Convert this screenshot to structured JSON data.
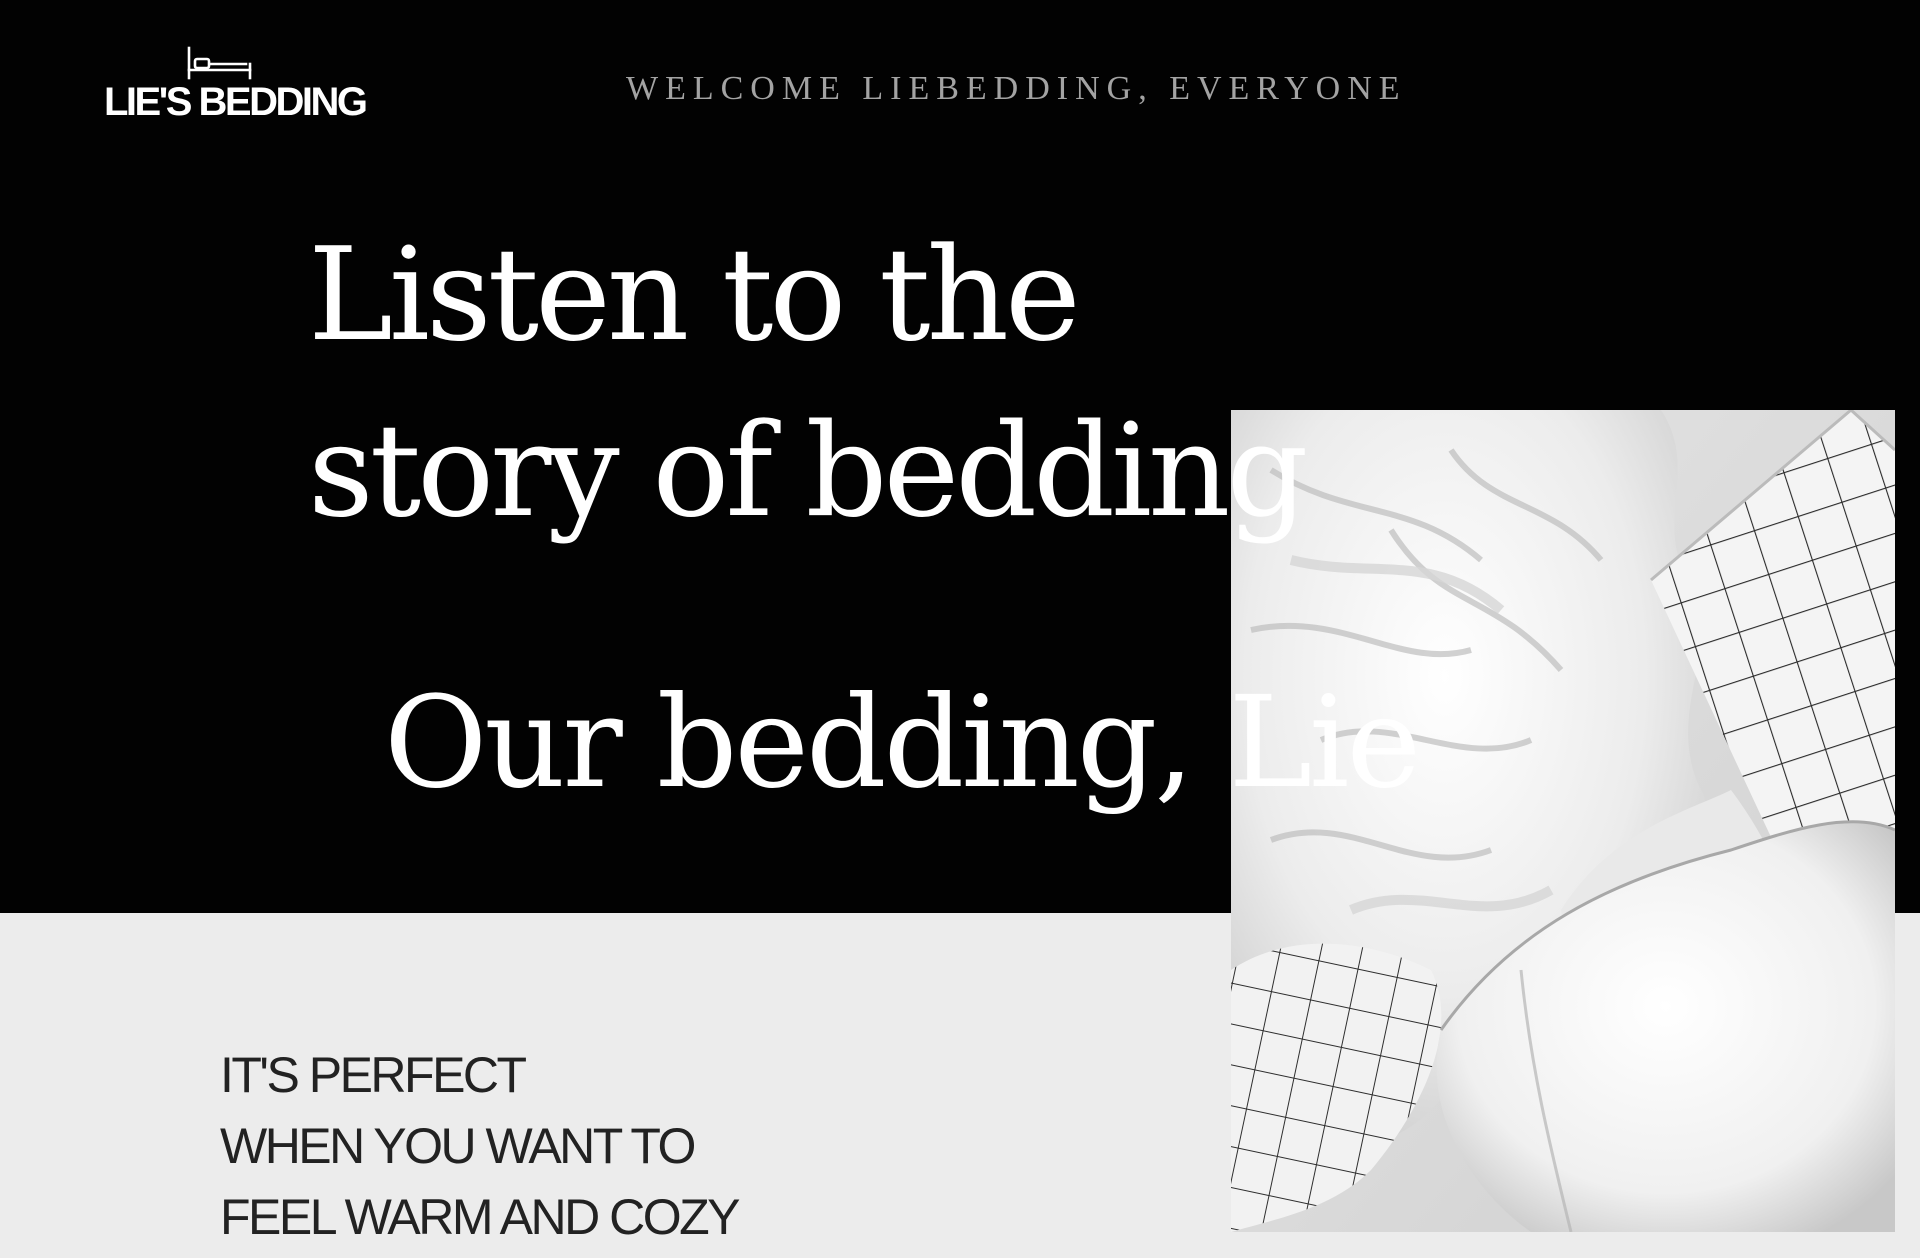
{
  "header": {
    "logo_text": "LIE'S BEDDING",
    "logo_icon": "bed-icon",
    "welcome": "WELCOME LIEBEDDING, EVERYONE"
  },
  "hero": {
    "headline_line1": "Listen to the",
    "headline_line2": "story of bedding",
    "subhead": "Our bedding, Lie",
    "image": "bedding-photo"
  },
  "intro": {
    "line1": "IT'S PERFECT",
    "line2": "WHEN YOU WANT TO",
    "line3": "FEEL WARM AND COZY"
  },
  "colors": {
    "hero_background": "#020202",
    "lower_background": "#ececec",
    "welcome_text": "#a3a3a3",
    "headline_text": "#ffffff",
    "tagline_text": "#222222"
  }
}
